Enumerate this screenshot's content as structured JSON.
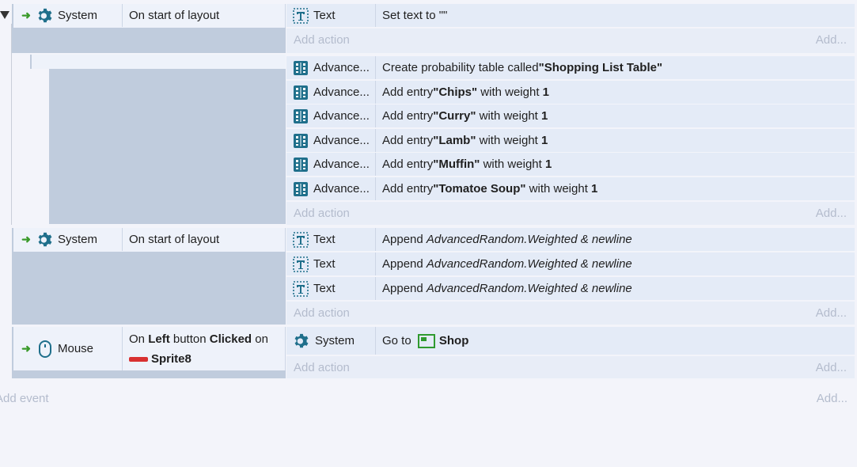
{
  "events": [
    {
      "object": "System",
      "condition": "On start of layout",
      "actions": [
        {
          "object": "Text",
          "text": "Set text to \"\""
        }
      ]
    },
    {
      "actions": [
        {
          "object": "Advance...",
          "pre": "Create probability table called ",
          "bold": "\"Shopping List Table\""
        },
        {
          "object": "Advance...",
          "pre": "Add entry ",
          "bold": "\"Chips\"",
          "mid": " with weight ",
          "num": "1"
        },
        {
          "object": "Advance...",
          "pre": "Add entry ",
          "bold": "\"Curry\"",
          "mid": " with weight ",
          "num": "1"
        },
        {
          "object": "Advance...",
          "pre": "Add entry ",
          "bold": "\"Lamb\"",
          "mid": " with weight ",
          "num": "1"
        },
        {
          "object": "Advance...",
          "pre": "Add entry ",
          "bold": "\"Muffin\"",
          "mid": " with weight ",
          "num": "1"
        },
        {
          "object": "Advance...",
          "pre": "Add entry ",
          "bold": "\"Tomatoe Soup\"",
          "mid": " with weight ",
          "num": "1"
        }
      ]
    },
    {
      "object": "System",
      "condition": "On start of layout",
      "actions": [
        {
          "object": "Text",
          "pre": "Append ",
          "italic": "AdvancedRandom.Weighted & newline"
        },
        {
          "object": "Text",
          "pre": "Append ",
          "italic": "AdvancedRandom.Weighted & newline"
        },
        {
          "object": "Text",
          "pre": "Append ",
          "italic": "AdvancedRandom.Weighted & newline"
        }
      ]
    },
    {
      "object": "Mouse",
      "condition": {
        "pre": "On ",
        "b1": "Left",
        "mid": " button ",
        "b2": "Clicked",
        "post": " on",
        "object": "Sprite8"
      },
      "actions": [
        {
          "object": "System",
          "pre": "Go to ",
          "bold": "Shop"
        }
      ]
    }
  ],
  "labels": {
    "add_action": "Add action",
    "add_short": "Add...",
    "add_event": "Add event"
  },
  "colors": {
    "accent_icon": "#1f6f8b",
    "arrow": "#3a9a2a",
    "sprite_red": "#d83030",
    "layout_icon": "#2f9a2f"
  }
}
